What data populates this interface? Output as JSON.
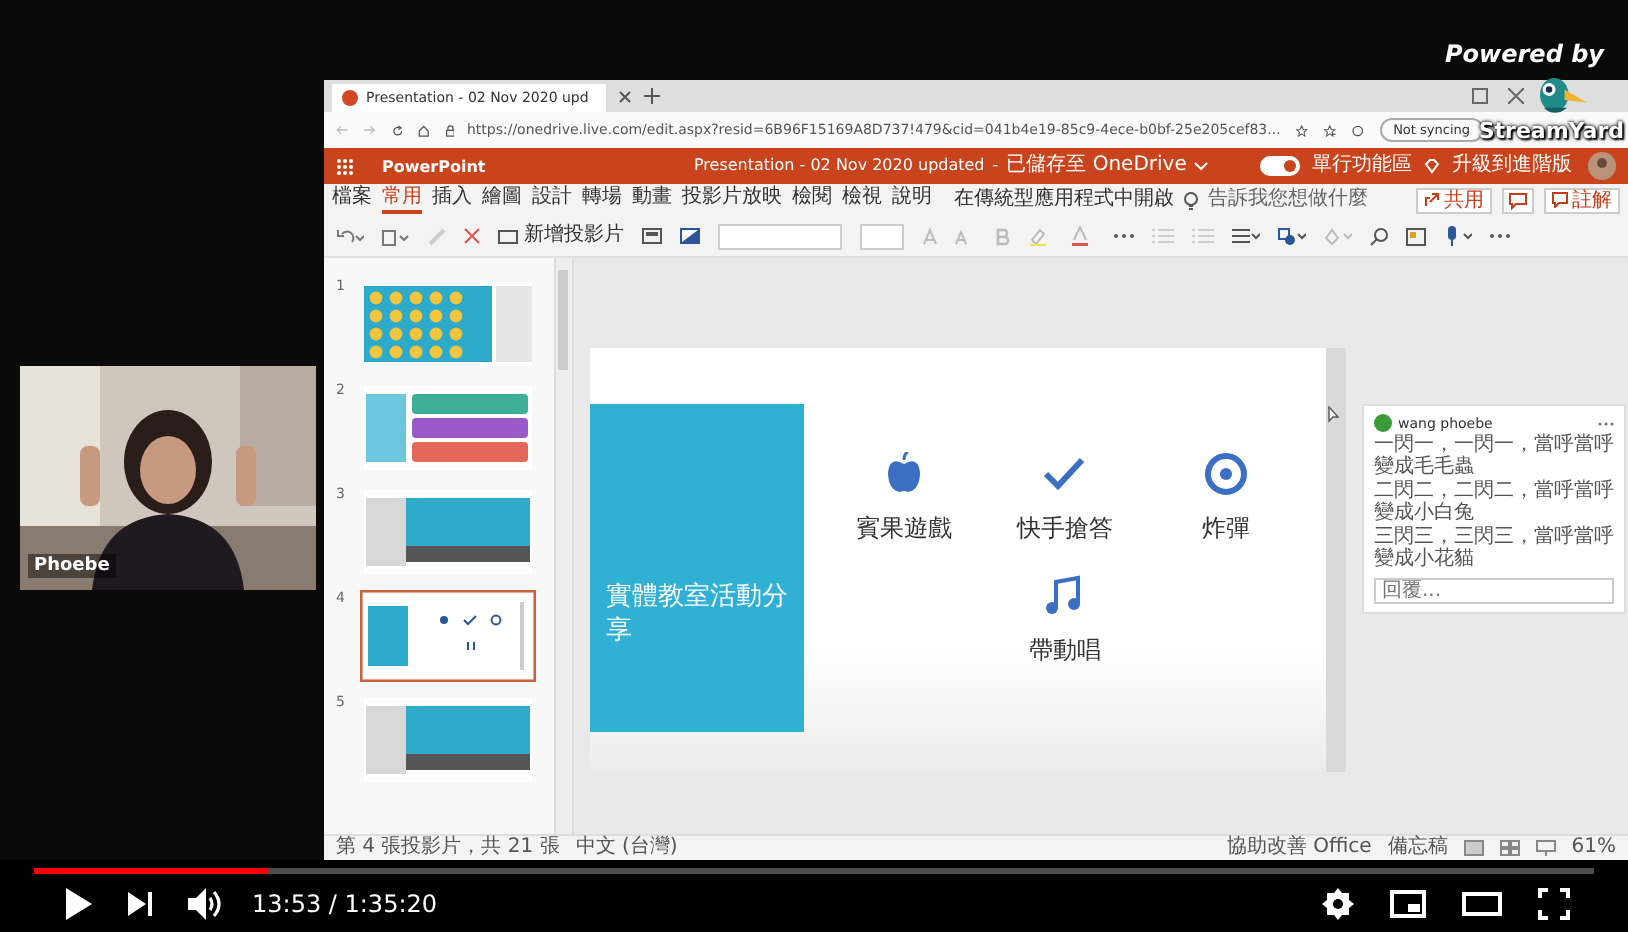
{
  "overlay": {
    "powered_by": "Powered by",
    "brand": "StreamYard"
  },
  "webcam": {
    "kind": "picture",
    "name": "Phoebe"
  },
  "browser": {
    "tab_title": "Presentation - 02 Nov 2020 upd",
    "url": "https://onedrive.live.com/edit.aspx?resid=6B96F15169A8D737!479&cid=041b4e19-85c9-4ece-b0bf-25e205cef83...",
    "sync_status": "Not syncing"
  },
  "app": {
    "name": "PowerPoint",
    "doc_title": "Presentation - 02 Nov 2020 updated",
    "separator": "-",
    "save_status": "已儲存至 OneDrive",
    "ribbon_toggle": {
      "label": "單行功能區",
      "on": true
    },
    "upgrade": "升級到進階版"
  },
  "ribbon": {
    "tabs": [
      {
        "label": "檔案",
        "selected": false
      },
      {
        "label": "常用",
        "selected": true
      },
      {
        "label": "插入",
        "selected": false
      },
      {
        "label": "繪圖",
        "selected": false
      },
      {
        "label": "設計",
        "selected": false
      },
      {
        "label": "轉場",
        "selected": false
      },
      {
        "label": "動畫",
        "selected": false
      },
      {
        "label": "投影片放映",
        "selected": false
      },
      {
        "label": "檢閱",
        "selected": false
      },
      {
        "label": "檢視",
        "selected": false
      },
      {
        "label": "說明",
        "selected": false
      }
    ],
    "open_desktop": "在傳統型應用程式中開啟",
    "tell_me": "告訴我您想做什麼",
    "share": "共用",
    "comments": "註解"
  },
  "toolbar": {
    "new_slide": "新增投影片"
  },
  "thumbnails": [
    {
      "number": "1",
      "kind": "title",
      "selected": false
    },
    {
      "number": "2",
      "kind": "list",
      "selected": false
    },
    {
      "number": "3",
      "kind": "section",
      "selected": false
    },
    {
      "number": "4",
      "kind": "content",
      "selected": true
    },
    {
      "number": "5",
      "kind": "section",
      "selected": false
    }
  ],
  "slide": {
    "title": "實體教室活動分享",
    "items": [
      {
        "kind": "apple",
        "label": "賓果遊戲"
      },
      {
        "kind": "check",
        "label": "快手搶答"
      },
      {
        "kind": "ball",
        "label": "炸彈"
      },
      {
        "kind": "note",
        "label": "帶動唱"
      }
    ]
  },
  "comment": {
    "author": "wang phoebe",
    "lines": [
      "一閃一，一閃一，當呼當呼變成毛毛蟲",
      "二閃二，二閃二，當呼當呼變成小白兔",
      "三閃三，三閃三，當呼當呼變成小花貓"
    ],
    "reply_placeholder": "回覆..."
  },
  "status_bar": {
    "slide_count": "第 4 張投影片，共 21 張",
    "language": "中文 (台灣)",
    "feedback": "協助改善 Office",
    "notes": "備忘稿",
    "zoom": "61%"
  },
  "player": {
    "progress": {
      "level": 0.15
    },
    "time": "13:53 / 1:35:20"
  }
}
